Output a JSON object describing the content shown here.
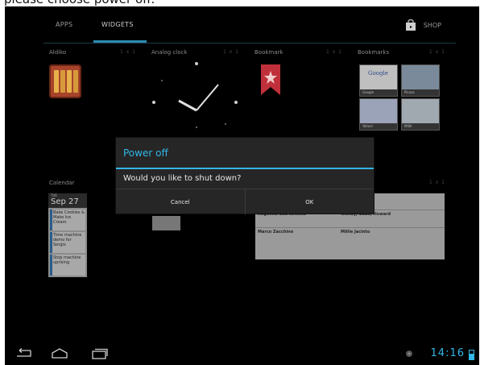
{
  "caption": "please choose power off.",
  "tabs": {
    "apps": "APPS",
    "widgets": "WIDGETS",
    "shop": "SHOP"
  },
  "widgets": {
    "aldiko": "Aldiko",
    "analog_clock": "Analog clock",
    "bookmark": "Bookmark",
    "bookmarks": "Bookmarks",
    "calendar": "Calendar",
    "page_dots": "1 x 1"
  },
  "calendar_card": {
    "day": "TUE",
    "date": "Sep 27",
    "events": [
      "Bake Cookies & Make Ice Cream",
      "Time machine demo for Sergio",
      "Stop machine uprising"
    ]
  },
  "bookmark_thumbs": [
    "Google",
    "Picasa",
    "Yahoo!",
    "MSN"
  ],
  "mail": {
    "rows": [
      "Angelina Szarkowska",
      "Marco Zacchino",
      "Wendy, Gabe, Howard",
      "Millie Jacinto"
    ]
  },
  "dialog": {
    "title": "Power off",
    "message": "Would you like to shut down?",
    "cancel": "Cancel",
    "ok": "OK"
  },
  "status": {
    "time": "14:16",
    "battery_level": 0.6
  },
  "colors": {
    "accent": "#31b6e7",
    "background": "#000000",
    "dialog": "#262626"
  }
}
